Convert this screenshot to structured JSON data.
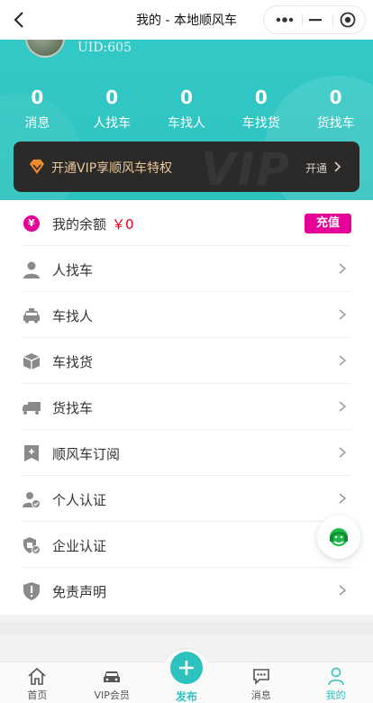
{
  "nav": {
    "title": "我的 - 本地顺风车"
  },
  "profile": {
    "uid": "UID:605"
  },
  "stats": [
    {
      "value": "0",
      "label": "消息"
    },
    {
      "value": "0",
      "label": "人找车"
    },
    {
      "value": "0",
      "label": "车找人"
    },
    {
      "value": "0",
      "label": "车找货"
    },
    {
      "value": "0",
      "label": "货找车"
    }
  ],
  "vip": {
    "text": "开通VIP享顺风车特权",
    "watermark": "VIP",
    "open": "开通"
  },
  "balance": {
    "label": "我的余额",
    "amount": "￥0",
    "recharge": "充值",
    "currency_glyph": "¥"
  },
  "menu": [
    {
      "label": "人找车",
      "icon": "person-icon"
    },
    {
      "label": "车找人",
      "icon": "car-icon"
    },
    {
      "label": "车找货",
      "icon": "package-icon"
    },
    {
      "label": "货找车",
      "icon": "truck-icon"
    },
    {
      "label": "顺风车订阅",
      "icon": "subscribe-icon"
    },
    {
      "label": "个人认证",
      "icon": "personal-verify-icon"
    },
    {
      "label": "企业认证",
      "icon": "enterprise-verify-icon"
    },
    {
      "label": "免责声明",
      "icon": "disclaimer-icon"
    }
  ],
  "tabs": [
    {
      "label": "首页",
      "icon": "home-icon"
    },
    {
      "label": "VIP会员",
      "icon": "vip-car-icon"
    },
    {
      "label": "发布",
      "icon": "plus-icon"
    },
    {
      "label": "消息",
      "icon": "chat-icon"
    },
    {
      "label": "我的",
      "icon": "user-icon"
    }
  ],
  "colors": {
    "primary": "#2ec2bf",
    "accent": "#e50097",
    "price": "#e2001a",
    "vip_bg": "#2b2a28",
    "vip_text": "#e7c8a1"
  }
}
